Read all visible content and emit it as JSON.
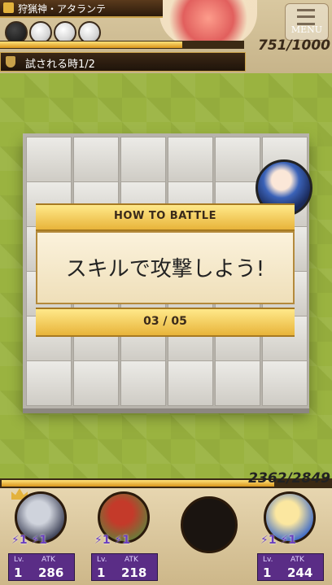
{
  "header": {
    "boss_name": "狩猟神・アタランテ",
    "menu_label": "MENU",
    "boss_hp_text": "751/1000",
    "boss_hp_fraction": 0.751,
    "quest_text": "試される時1/2",
    "orbs": [
      "dark",
      "light",
      "light",
      "light"
    ]
  },
  "popup": {
    "title": "HOW TO BATTLE",
    "message": "スキルで攻撃しよう!",
    "page": "03 / 05"
  },
  "party": {
    "hp_text": "2362/2849",
    "hp_fraction": 0.829,
    "units": [
      {
        "name": "unit-1",
        "skills": "⚡1 ⚡1",
        "lv_label": "Lv.",
        "lv": "1",
        "atk_label": "ATK",
        "atk": "286",
        "colors": [
          "#cfd3dc",
          "#3b3f55"
        ]
      },
      {
        "name": "unit-2",
        "skills": "⚡1 ⚡1",
        "lv_label": "Lv.",
        "lv": "1",
        "atk_label": "ATK",
        "atk": "218",
        "colors": [
          "#c43a2a",
          "#6c7a3a"
        ]
      },
      {
        "name": "unit-4",
        "skills": "⚡1 ⚡1",
        "lv_label": "Lv.",
        "lv": "1",
        "atk_label": "ATK",
        "atk": "244",
        "colors": [
          "#fbe7a0",
          "#3d6ac8"
        ]
      }
    ]
  },
  "colors": {
    "accent_gold": "#e8b43a",
    "stat_purple": "#5a2d86",
    "grass": "#9ab340"
  }
}
